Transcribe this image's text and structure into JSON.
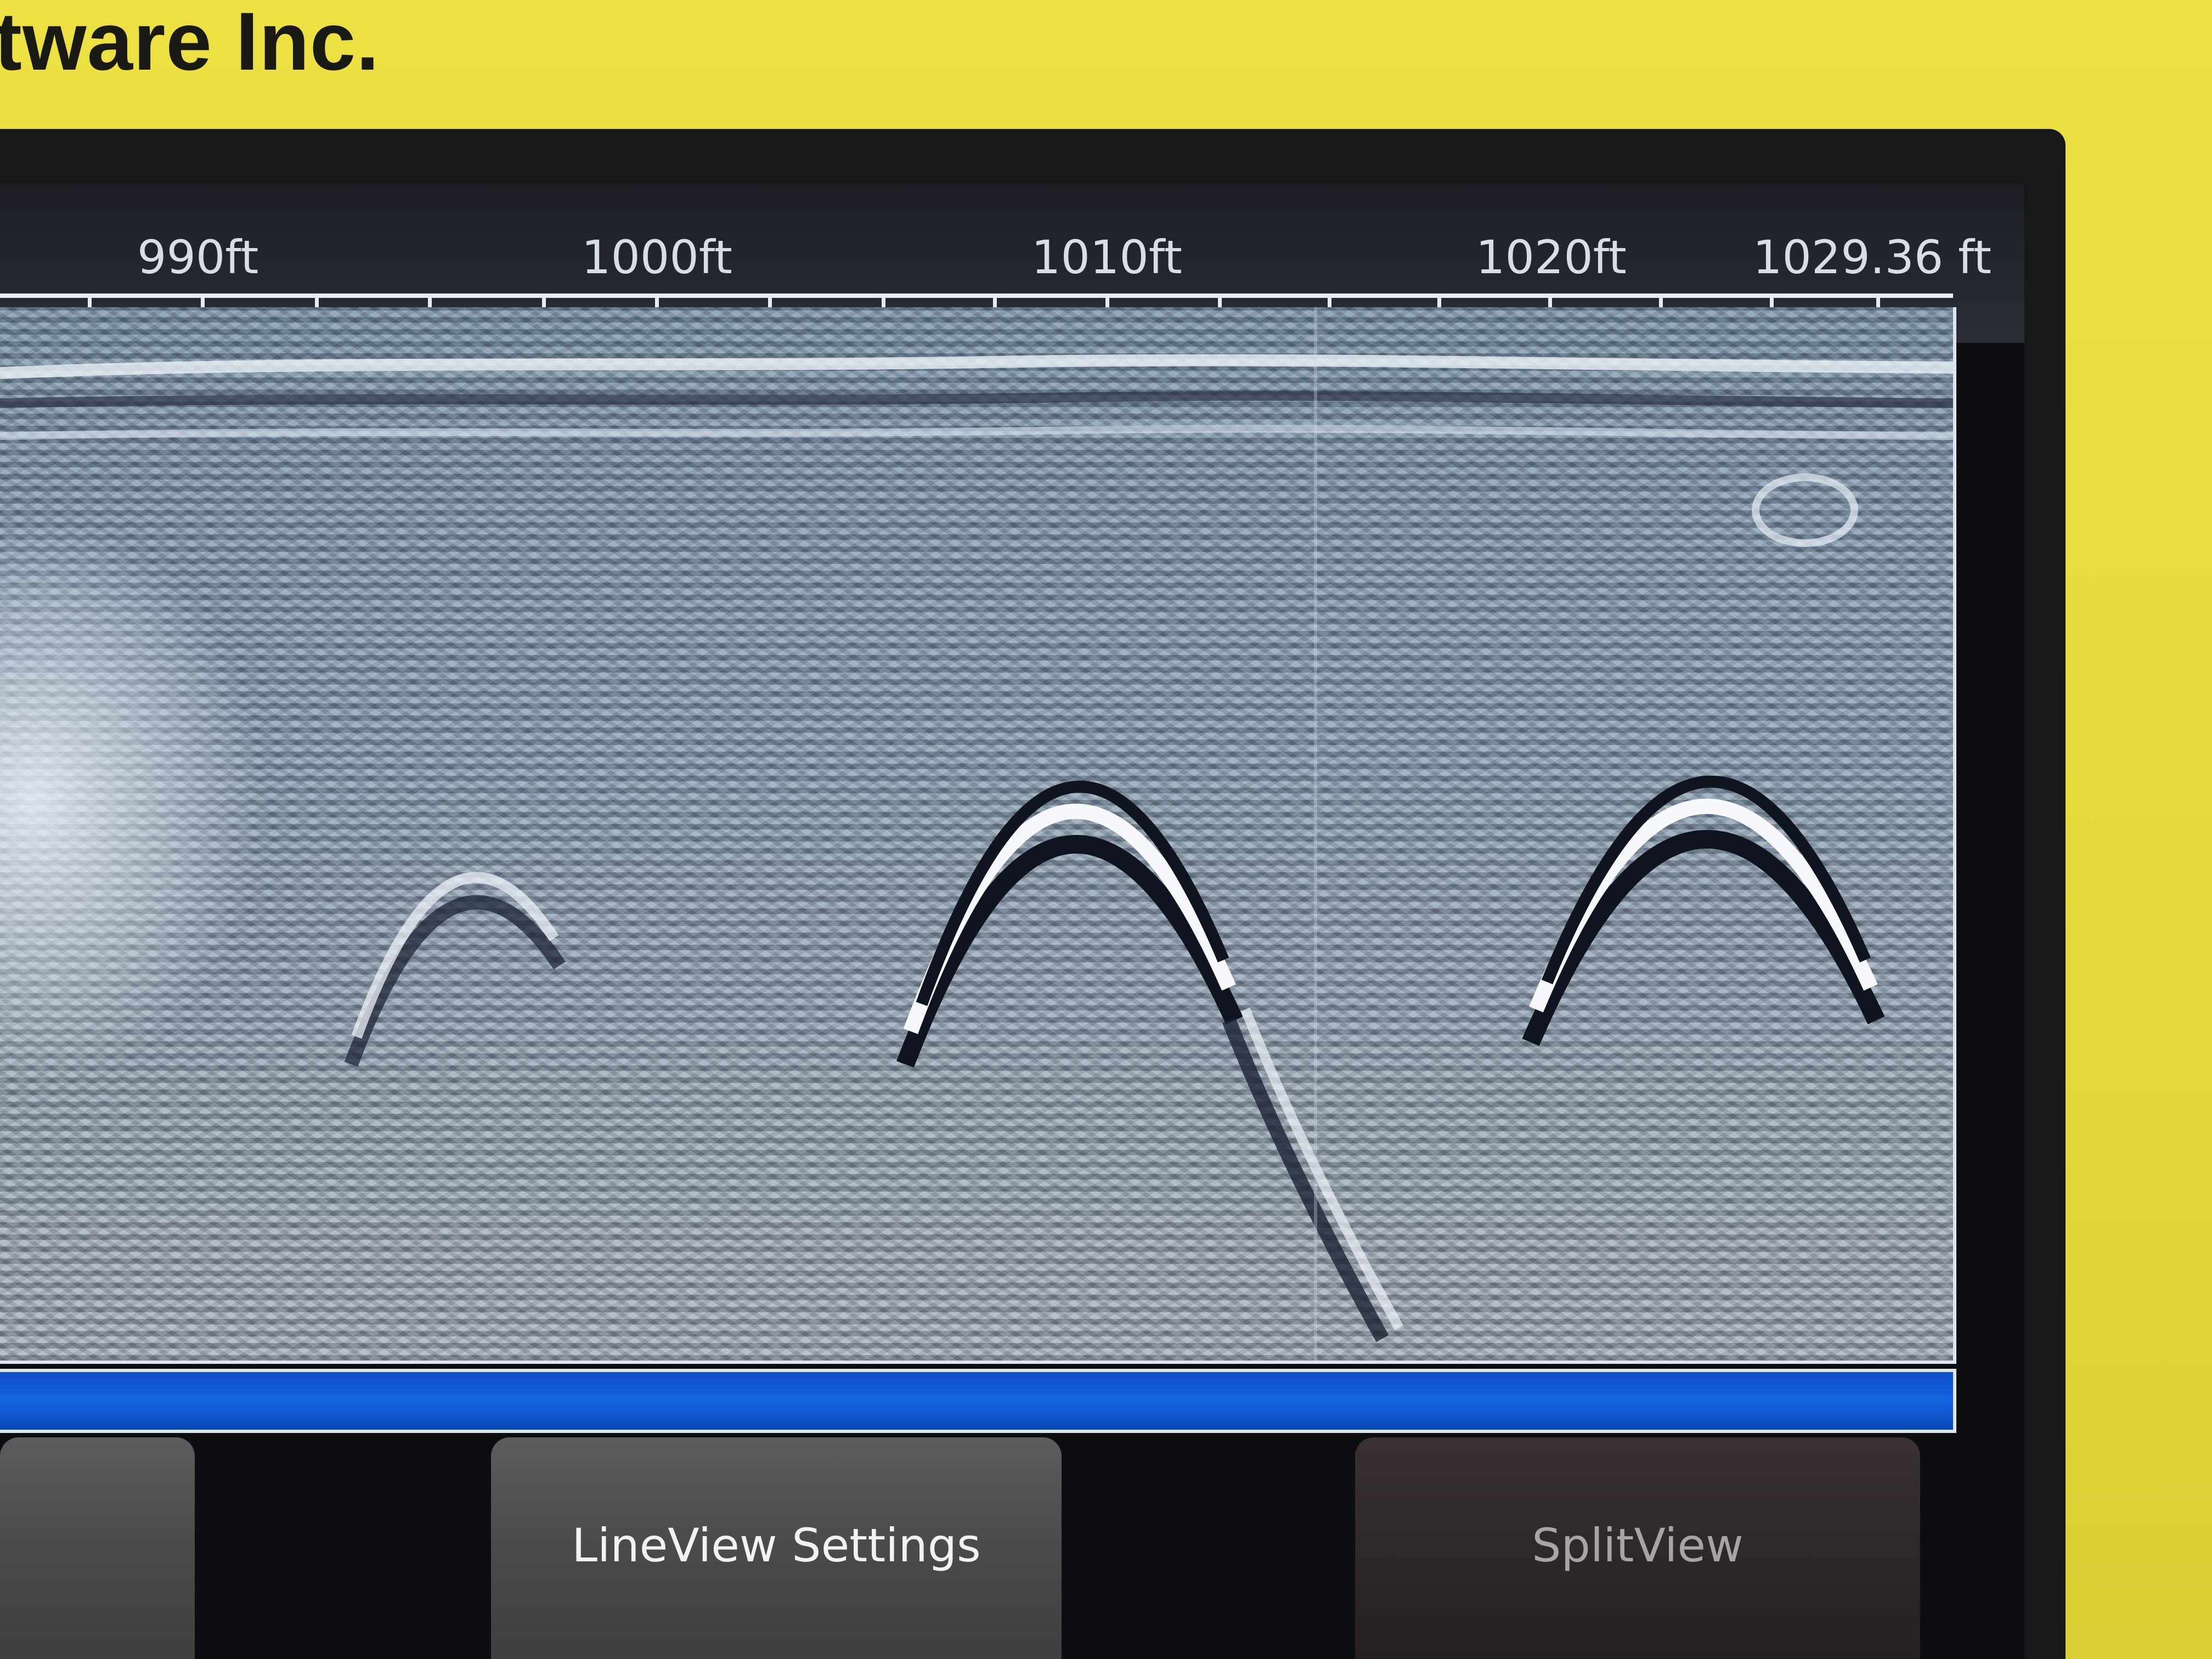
{
  "brand": {
    "text": "tware Inc."
  },
  "ruler": {
    "labels": [
      "990ft",
      "1000ft",
      "1010ft",
      "1020ft",
      "1029.36 ft"
    ]
  },
  "softkeys": {
    "left_label": "",
    "center_label": "LineView Settings",
    "right_label": "SplitView"
  },
  "colors": {
    "device_body": "#e6d83a",
    "status_bar": "#1565e0",
    "softkey": "#4a4a4a"
  }
}
